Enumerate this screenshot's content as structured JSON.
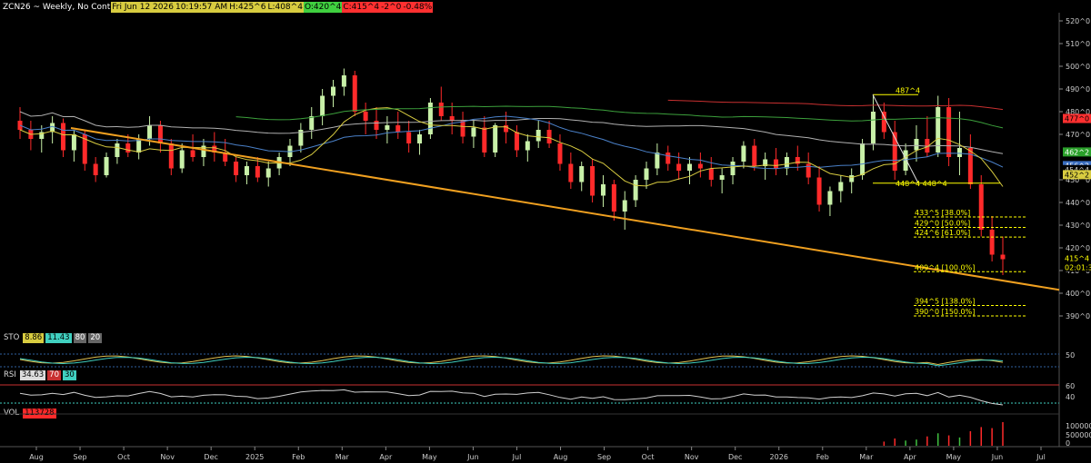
{
  "header": {
    "symbol": "ZCN26 ~ Weekly, No Cont",
    "date": "Fri Jun 12 2026",
    "time": "10:19:57 AM",
    "high": "H:425^6",
    "low": "L:408^4",
    "open": "O:420^4",
    "close": "C:415^4",
    "change": "-2^0",
    "change_pct": "-0.48%"
  },
  "colors": {
    "bg": "#000000",
    "up": "#c8f0a8",
    "down": "#ff2a2a",
    "trendline": "#f0a020",
    "fib": "#ffff00",
    "ma_short": "#d8cc40",
    "ma_mid": "#4a80c8",
    "ma_long": "#b0b0b0",
    "ma_green": "#3ca03c",
    "ma_red": "#c83030",
    "sto_k": "#e0c050",
    "sto_d": "#40d0c0",
    "rsi": "#d0d0d0"
  },
  "price_axis": {
    "ticks": [
      "520^0",
      "510^0",
      "500^0",
      "490^0",
      "480^0",
      "470^0",
      "450^0",
      "440^0",
      "430^0",
      "420^0",
      "410^0",
      "400^0",
      "390^0"
    ],
    "tags": [
      {
        "text": "477^0",
        "color": "#ff3030",
        "fg": "#000"
      },
      {
        "text": "462^2",
        "color": "#2aa02a",
        "fg": "#fff"
      },
      {
        "text": "456^2",
        "color": "#3a6ec0",
        "fg": "#fff"
      },
      {
        "text": "454^4",
        "color": "#000000",
        "fg": "#ccc"
      },
      {
        "text": "452^2",
        "color": "#d8cc40",
        "fg": "#000"
      },
      {
        "text": "415^4",
        "color": "#000000",
        "fg": "#ffff00"
      },
      {
        "text": "02:01:3",
        "color": "#000000",
        "fg": "#ffff00"
      }
    ]
  },
  "time_axis": {
    "labels": [
      "Aug",
      "Sep",
      "Oct",
      "Nov",
      "Dec",
      "2025",
      "Feb",
      "Mar",
      "Apr",
      "May",
      "Jun",
      "Jul",
      "Aug",
      "Sep",
      "Oct",
      "Nov",
      "Dec",
      "2026",
      "Feb",
      "Mar",
      "Apr",
      "May",
      "Jun",
      "Jul"
    ]
  },
  "annotations": {
    "swing_high": "487^4",
    "swing_low": "448^4",
    "swing_low2": "448^4",
    "fib_levels": [
      {
        "label": "433^5 [38.0%]",
        "value": 433.6
      },
      {
        "label": "429^0 [50.0%]",
        "value": 429.0
      },
      {
        "label": "424^6 [61.0%]",
        "value": 424.75
      },
      {
        "label": "409^4 [100.0%]",
        "value": 409.5
      },
      {
        "label": "394^5 [138.0%]",
        "value": 394.6
      },
      {
        "label": "390^0 [150.0%]",
        "value": 390.0
      }
    ]
  },
  "panels": {
    "sto": {
      "label": "STO",
      "k": "8.86",
      "d": "11.43",
      "upper": "80",
      "lower": "20",
      "axis": [
        "50"
      ]
    },
    "rsi": {
      "label": "RSI",
      "value": "34.63",
      "upper": "70",
      "lower": "30",
      "axis": [
        "60",
        "40"
      ]
    },
    "vol": {
      "label": "VOL",
      "value": "113728",
      "axis": [
        "100000",
        "500000",
        "0"
      ]
    }
  },
  "chart_data": {
    "type": "candlestick",
    "ylim": [
      385,
      525
    ],
    "candles": [
      [
        476,
        482,
        468,
        472
      ],
      [
        472,
        476,
        463,
        468
      ],
      [
        468,
        474,
        462,
        471
      ],
      [
        471,
        478,
        466,
        475
      ],
      [
        475,
        477,
        460,
        463
      ],
      [
        463,
        472,
        458,
        470
      ],
      [
        470,
        472,
        454,
        457
      ],
      [
        457,
        460,
        449,
        452
      ],
      [
        452,
        462,
        451,
        460
      ],
      [
        460,
        468,
        457,
        466
      ],
      [
        466,
        470,
        460,
        462
      ],
      [
        462,
        470,
        459,
        468
      ],
      [
        468,
        478,
        465,
        474
      ],
      [
        474,
        476,
        462,
        466
      ],
      [
        466,
        468,
        452,
        455
      ],
      [
        455,
        466,
        453,
        463
      ],
      [
        463,
        470,
        458,
        460
      ],
      [
        460,
        468,
        456,
        465
      ],
      [
        465,
        471,
        458,
        462
      ],
      [
        462,
        468,
        456,
        458
      ],
      [
        458,
        460,
        449,
        452
      ],
      [
        452,
        458,
        448,
        456
      ],
      [
        456,
        460,
        449,
        451
      ],
      [
        451,
        458,
        447,
        455
      ],
      [
        455,
        462,
        452,
        460
      ],
      [
        460,
        468,
        456,
        465
      ],
      [
        465,
        475,
        462,
        472
      ],
      [
        472,
        482,
        468,
        478
      ],
      [
        478,
        490,
        474,
        487
      ],
      [
        487,
        494,
        482,
        491
      ],
      [
        491,
        499,
        487,
        496
      ],
      [
        496,
        498,
        478,
        480
      ],
      [
        480,
        484,
        470,
        476
      ],
      [
        476,
        482,
        468,
        472
      ],
      [
        472,
        478,
        466,
        474
      ],
      [
        474,
        480,
        468,
        471
      ],
      [
        471,
        476,
        462,
        466
      ],
      [
        466,
        472,
        461,
        470
      ],
      [
        470,
        486,
        468,
        484
      ],
      [
        484,
        491,
        476,
        478
      ],
      [
        478,
        484,
        470,
        476
      ],
      [
        476,
        480,
        466,
        469
      ],
      [
        469,
        476,
        464,
        473
      ],
      [
        473,
        478,
        460,
        462
      ],
      [
        462,
        475,
        460,
        474
      ],
      [
        474,
        480,
        466,
        471
      ],
      [
        471,
        474,
        460,
        463
      ],
      [
        463,
        470,
        458,
        467
      ],
      [
        467,
        476,
        464,
        472
      ],
      [
        472,
        476,
        464,
        466
      ],
      [
        466,
        470,
        454,
        457
      ],
      [
        457,
        462,
        446,
        449
      ],
      [
        449,
        458,
        445,
        456
      ],
      [
        456,
        459,
        440,
        443
      ],
      [
        443,
        452,
        438,
        448
      ],
      [
        448,
        450,
        432,
        436
      ],
      [
        436,
        445,
        428,
        441
      ],
      [
        441,
        452,
        438,
        450
      ],
      [
        450,
        458,
        446,
        455
      ],
      [
        455,
        466,
        452,
        462
      ],
      [
        462,
        465,
        454,
        457
      ],
      [
        457,
        462,
        450,
        454
      ],
      [
        454,
        460,
        448,
        457
      ],
      [
        457,
        462,
        451,
        455
      ],
      [
        455,
        460,
        447,
        450
      ],
      [
        450,
        455,
        444,
        452
      ],
      [
        452,
        460,
        448,
        458
      ],
      [
        458,
        467,
        455,
        465
      ],
      [
        465,
        468,
        454,
        456
      ],
      [
        456,
        462,
        450,
        459
      ],
      [
        459,
        464,
        452,
        455
      ],
      [
        455,
        462,
        452,
        460
      ],
      [
        460,
        465,
        454,
        457
      ],
      [
        457,
        462,
        448,
        451
      ],
      [
        451,
        456,
        436,
        439
      ],
      [
        439,
        447,
        434,
        445
      ],
      [
        445,
        452,
        440,
        449
      ],
      [
        449,
        455,
        444,
        452
      ],
      [
        452,
        468,
        450,
        466
      ],
      [
        466,
        487,
        463,
        480
      ],
      [
        480,
        484,
        468,
        471
      ],
      [
        471,
        476,
        450,
        454
      ],
      [
        454,
        466,
        452,
        463
      ],
      [
        463,
        474,
        458,
        468
      ],
      [
        468,
        478,
        460,
        462
      ],
      [
        462,
        487,
        460,
        482
      ],
      [
        482,
        486,
        456,
        460
      ],
      [
        460,
        480,
        452,
        464
      ],
      [
        464,
        470,
        446,
        448
      ],
      [
        448,
        452,
        425,
        428
      ],
      [
        428,
        434,
        414,
        417
      ],
      [
        417,
        425,
        408,
        415
      ]
    ],
    "trendline": [
      [
        78,
        472.8
      ],
      [
        1165,
        401.5
      ]
    ],
    "volume_last": [
      20000,
      35000,
      25000,
      30000,
      45000,
      60000,
      50000,
      40000,
      70000,
      90000,
      85000,
      113728
    ]
  }
}
